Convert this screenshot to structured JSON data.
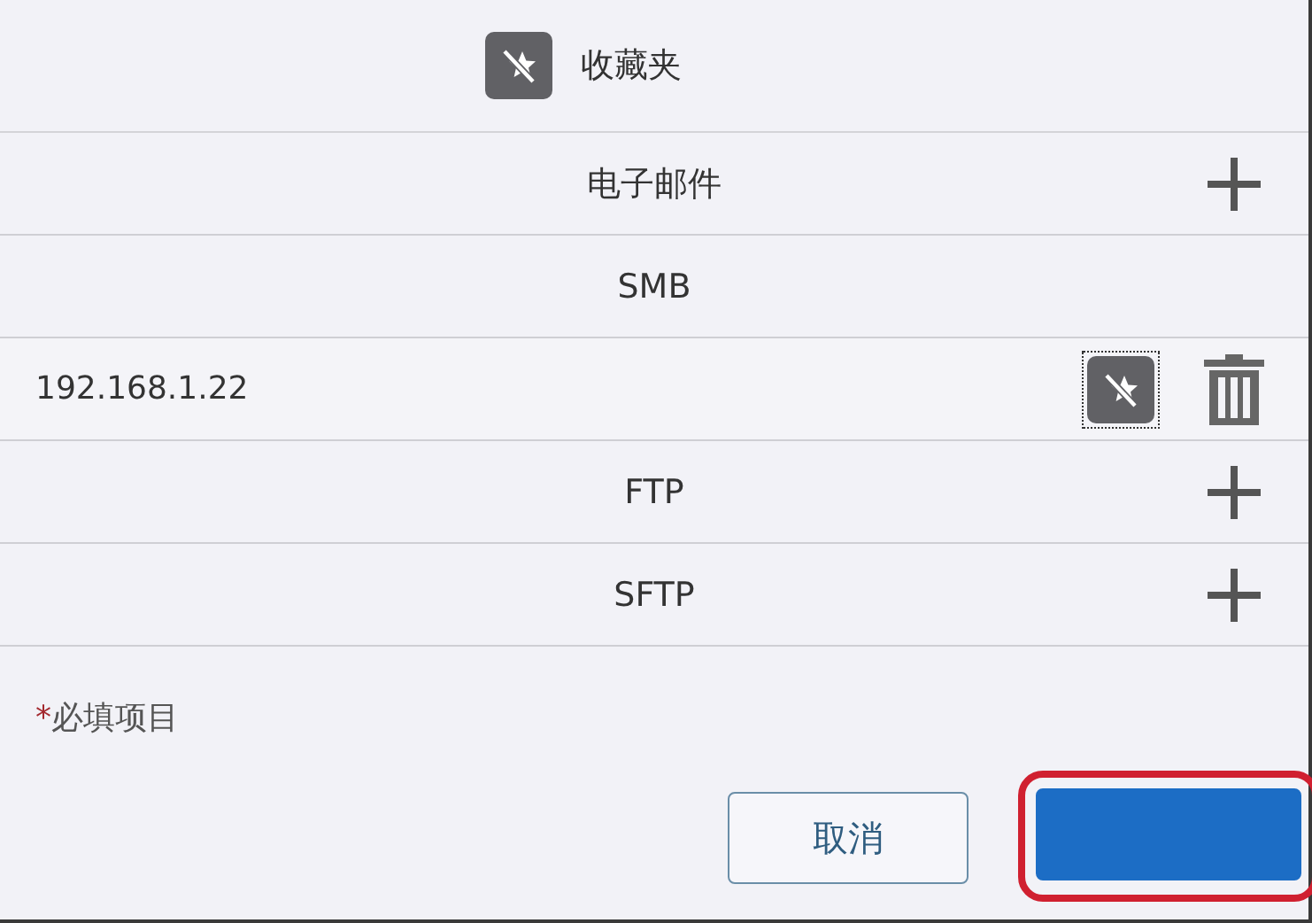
{
  "header": {
    "title": "收藏夹"
  },
  "rows": [
    {
      "kind": "group",
      "label": "电子邮件",
      "addable": true
    },
    {
      "kind": "group",
      "label": "SMB",
      "addable": false
    },
    {
      "kind": "entry",
      "label": "192.168.1.22",
      "focused": true
    },
    {
      "kind": "group",
      "label": "FTP",
      "addable": true
    },
    {
      "kind": "group",
      "label": "SFTP",
      "addable": true
    }
  ],
  "required_note": {
    "mark": "*",
    "text": "必填项目"
  },
  "buttons": [
    {
      "kind": "secondary",
      "label": "取消",
      "highlighted": false
    },
    {
      "kind": "primary",
      "highlighted": true
    }
  ]
}
